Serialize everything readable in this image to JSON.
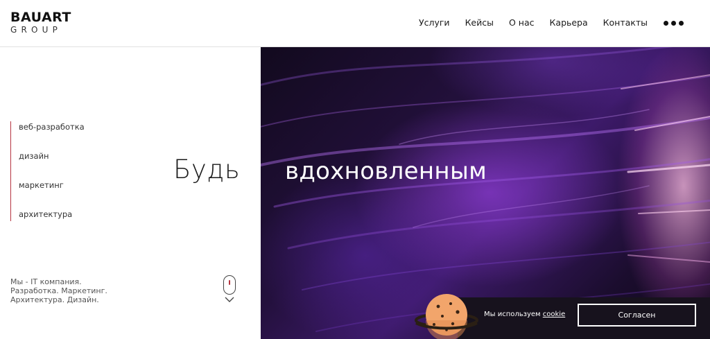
{
  "header": {
    "logo_main": "BAUART",
    "logo_sub": "GROUP",
    "nav": [
      "Услуги",
      "Кейсы",
      "О нас",
      "Карьера",
      "Контакты"
    ],
    "more_icon": "ellipsis-icon"
  },
  "left": {
    "categories": [
      "веб-разработка",
      "дизайн",
      "маркетинг",
      "архитектура"
    ],
    "headline": "Будь",
    "about_lines": [
      "Мы - IT компания.",
      "Разработка. Маркетинг.",
      "Архитектура. Дизайн."
    ],
    "accent_color": "#b5333f"
  },
  "hero": {
    "headline": "вдохновленным"
  },
  "cookie": {
    "text_prefix": "Мы используем ",
    "link": "cookie",
    "button": "Согласен"
  }
}
